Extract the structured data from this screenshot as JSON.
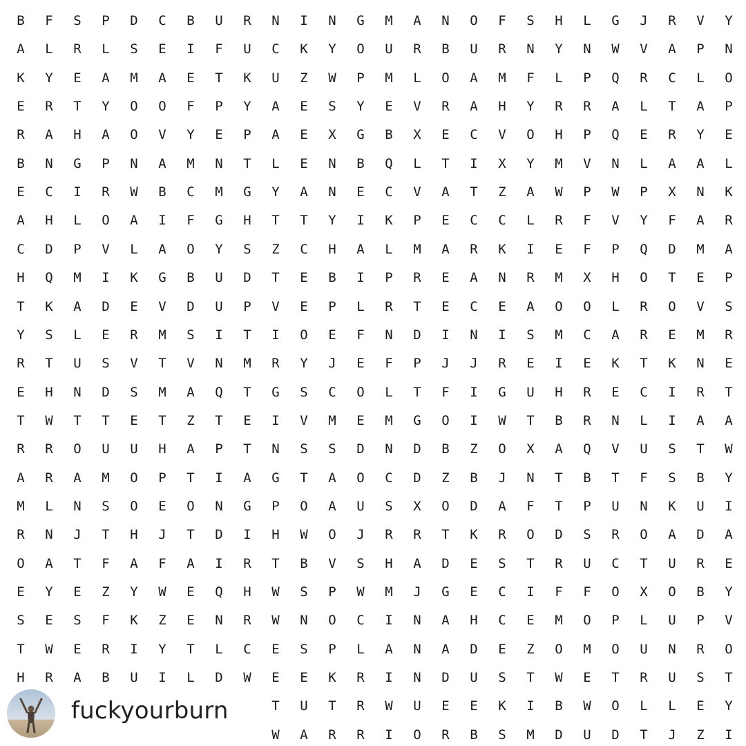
{
  "puzzle": {
    "rows": [
      "BFSPDCBURNINGMANOFSHLGJRVY",
      "ALRLSEIFUCKYOURBURNYNWVAPN",
      "KYEAMAETKUZWPMLOAMFLPQRCLO",
      "ERTYOOFPYAESYEVRAHYRRALTAP",
      "RAHAOVYEPAEXGBXECVOHPQERYE",
      "BNGPNAMNTLENBQLTIXYMVNLAAL",
      "ECIRWBCMGYANECVATZAWPWPXNK",
      "AHLOAIFGHTTYIKPECCLRFVYFAR",
      "CDPVLAOYSZCHALMARKIEFPQDMA",
      "HQMIKGBUDTEBIPREANRMXHOTEP",
      "TKADEVDUPVEPLRTECEAOOLROVS",
      "YSLERMSITIOEFNDINISMCAREMR",
      "RTUSVTVNMRYJEFPJJREIEKTKNE",
      "EHNDSMAQTGSCOLTFIGUHRECIRT",
      "TWTTETZTEIVMEMGOIWTBRNLIAA",
      "RROUUHAPTNSSDNDBZOXAQVUSTW",
      "ARAMOPTIAGTAOCDZBJNTBTFSBY",
      "MLNSOEONGPOAUSXODAFTPUNKUI",
      "RNJTHJTDIHWOJRRTKRODSROADA",
      "OATFAFAIRTBVSHADESTRUCTURE",
      "EYEZYWEQHWSPWMJGECIFFOXOBY",
      "SESFKZENRWNOCINAHCEMOPLUPV",
      "TWERIYTLCESPLANADEZOMOUNRO",
      "HRABUILDWEEKRINDUSTWETRUST"
    ],
    "partial_rows": [
      "TUTRWUEEKIBWOLLEY",
      "WARRIORBSMDUDTJZI"
    ]
  },
  "credit": {
    "username": "fuckyourburn",
    "avatar_icon": "profile-photo-person-arms-raised-icon"
  },
  "colors": {
    "letters": "#1a1a1a",
    "background": "#ffffff"
  }
}
